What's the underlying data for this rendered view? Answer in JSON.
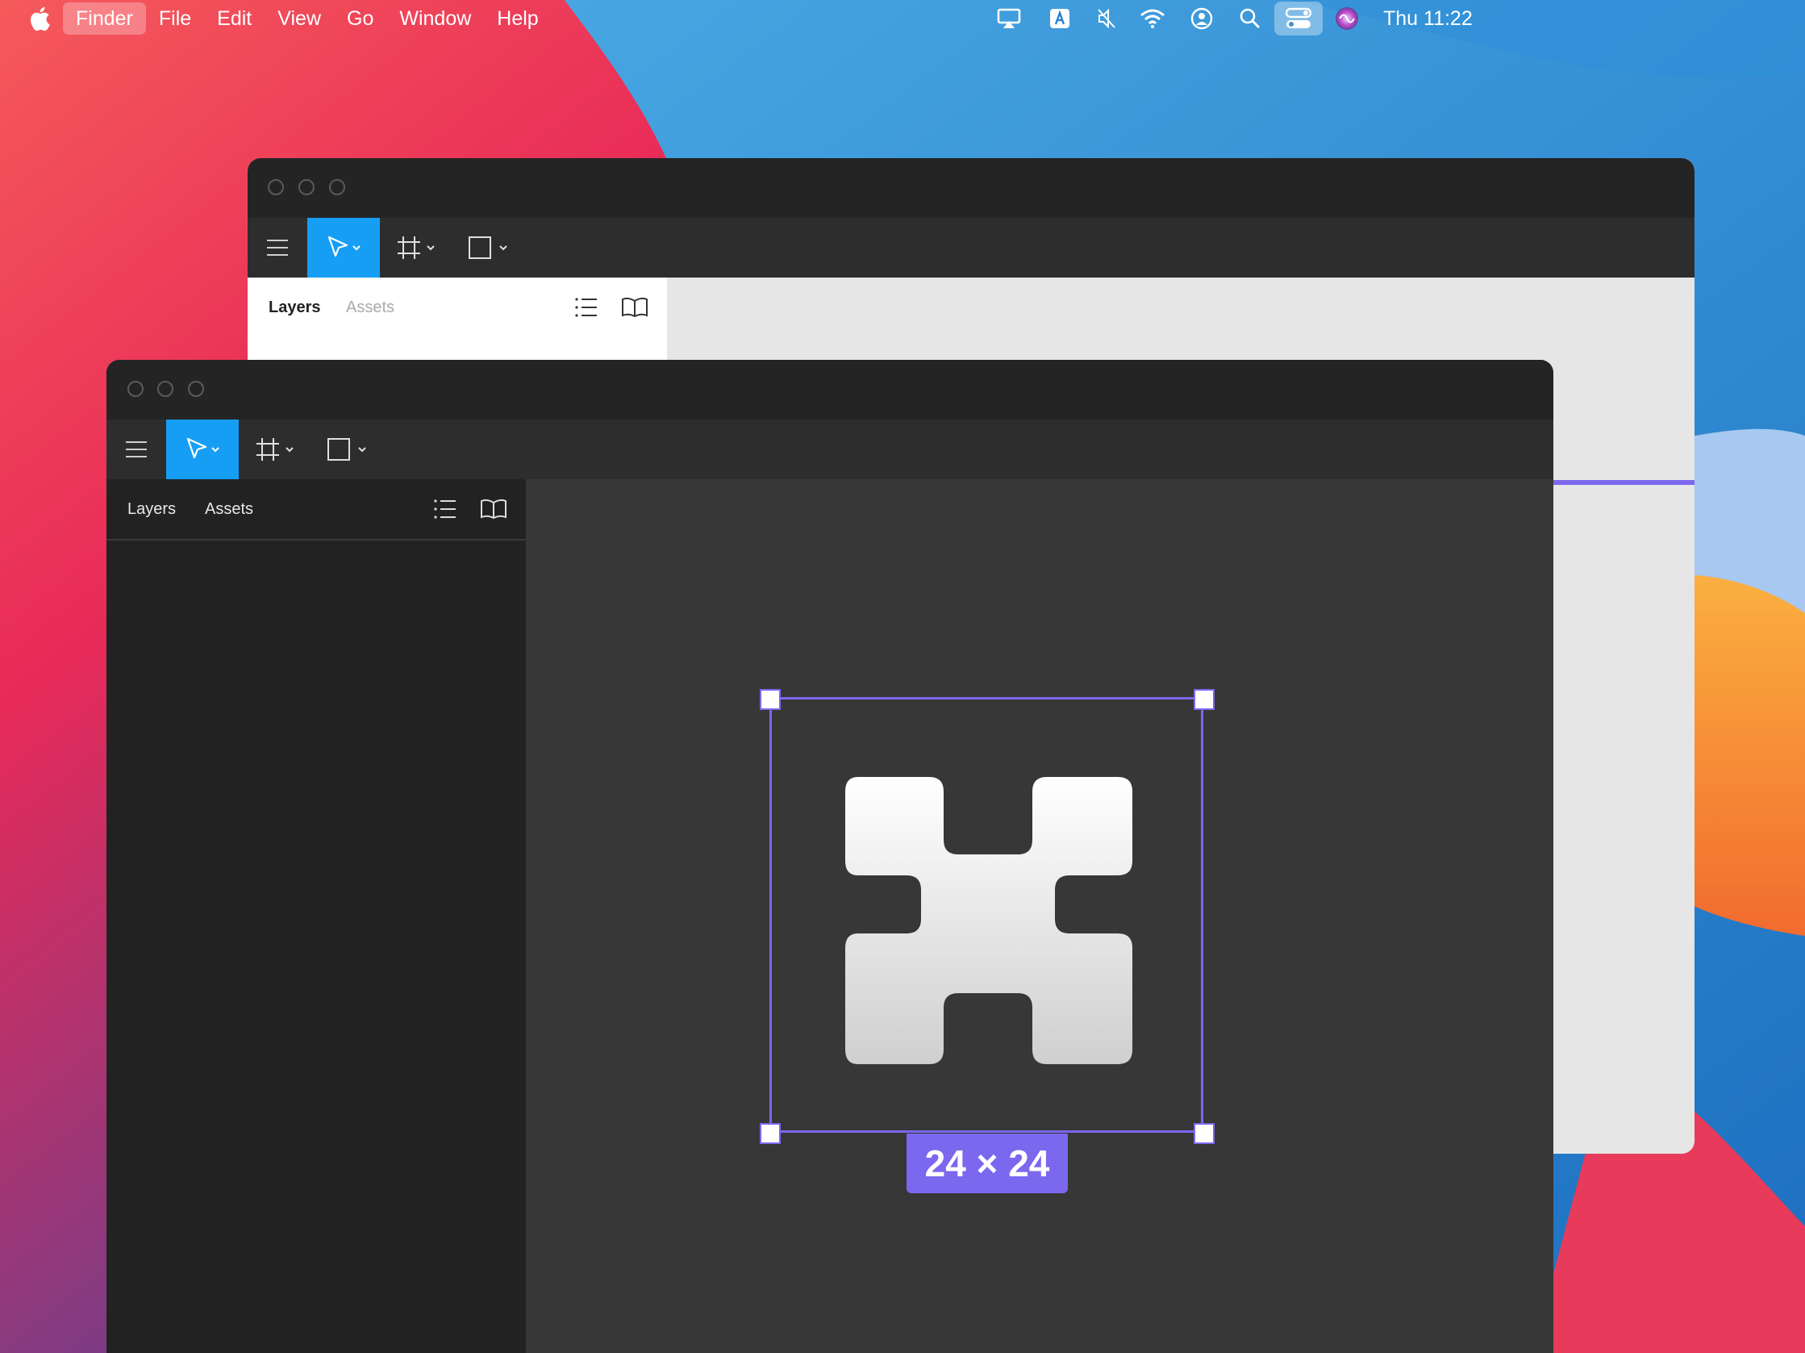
{
  "menubar": {
    "items": [
      "Finder",
      "File",
      "Edit",
      "View",
      "Go",
      "Window",
      "Help"
    ],
    "active": "Finder",
    "clock": "Thu 11:22",
    "status_icons": [
      "airplay-icon",
      "input-source-icon",
      "mute-icon",
      "wifi-icon",
      "user-icon",
      "spotlight-icon",
      "control-center-icon",
      "siri-icon"
    ]
  },
  "back_window": {
    "tabs": {
      "layers": "Layers",
      "assets": "Assets"
    }
  },
  "front_window": {
    "tabs": {
      "layers": "Layers",
      "assets": "Assets"
    },
    "selection_size": "24 × 24"
  },
  "colors": {
    "accent": "#169ef5",
    "selection": "#7b68ee"
  }
}
